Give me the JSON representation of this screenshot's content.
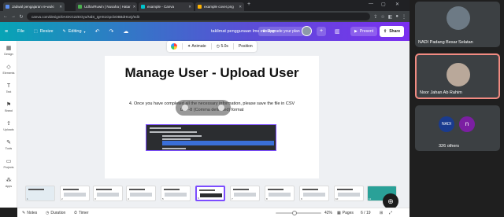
{
  "browser": {
    "tabs": [
      {
        "label": "Jadwal pengajaran re-wuki",
        "color": "#5b8def"
      },
      {
        "label": "UdharRuwin | Nusaha | Hatar",
        "color": "#4caf50"
      },
      {
        "label": "example - Canva",
        "color": "#00c4cc"
      },
      {
        "label": "example cover.png",
        "color": "#ffb300"
      }
    ],
    "url": "canva.com/design/DAGKG2ZEOyu/NdS_IgHS1GpcbOBBdHtoQ/edit"
  },
  "canva": {
    "menu": {
      "file": "File",
      "resize": "Resize",
      "editing": "Editing"
    },
    "doc_title": "taklimat penggunaan lms eusikan",
    "upgrade": "Upgrade your plan",
    "present": "Present",
    "share": "Share"
  },
  "sidebar": {
    "items": [
      {
        "label": "Design",
        "icon": "layout-icon"
      },
      {
        "label": "Elements",
        "icon": "shapes-icon"
      },
      {
        "label": "Text",
        "icon": "text-icon"
      },
      {
        "label": "Brand",
        "icon": "brand-icon"
      },
      {
        "label": "Uploads",
        "icon": "upload-icon"
      },
      {
        "label": "Tools",
        "icon": "tools-icon"
      },
      {
        "label": "Projects",
        "icon": "folder-icon"
      },
      {
        "label": "Apps",
        "icon": "apps-icon"
      }
    ]
  },
  "floating_toolbar": {
    "animate": "Animate",
    "duration": "5.0s",
    "position": "Position"
  },
  "slide": {
    "title": "Manage User - Upload User",
    "text": "4. Once you have completed all the necessary information, please save the file in CSV UTF-8 (Comma delimited) format"
  },
  "filmstrip": {
    "selected": 6,
    "count": 11,
    "numbers": [
      "1",
      "2",
      "3",
      "4",
      "5",
      "6",
      "7",
      "8",
      "9",
      "10",
      "11"
    ]
  },
  "bottom": {
    "notes": "Notes",
    "duration": "Duration",
    "timer": "Timer",
    "zoom": "42%",
    "zoom_fraction": 0.42,
    "pages_label": "Pages",
    "page_counter": "6 / 19"
  },
  "meeting": {
    "tiles": [
      {
        "name": "NADI Padang Besar Selatan"
      },
      {
        "name": "Noor Jahan Ab Rahim"
      },
      {
        "name": "326 others",
        "initial": "n",
        "badge": "NADI"
      }
    ]
  },
  "colors": {
    "accent": "#7c4dff",
    "canva_start": "#07a4b5",
    "canva_end": "#7b2ff0"
  }
}
